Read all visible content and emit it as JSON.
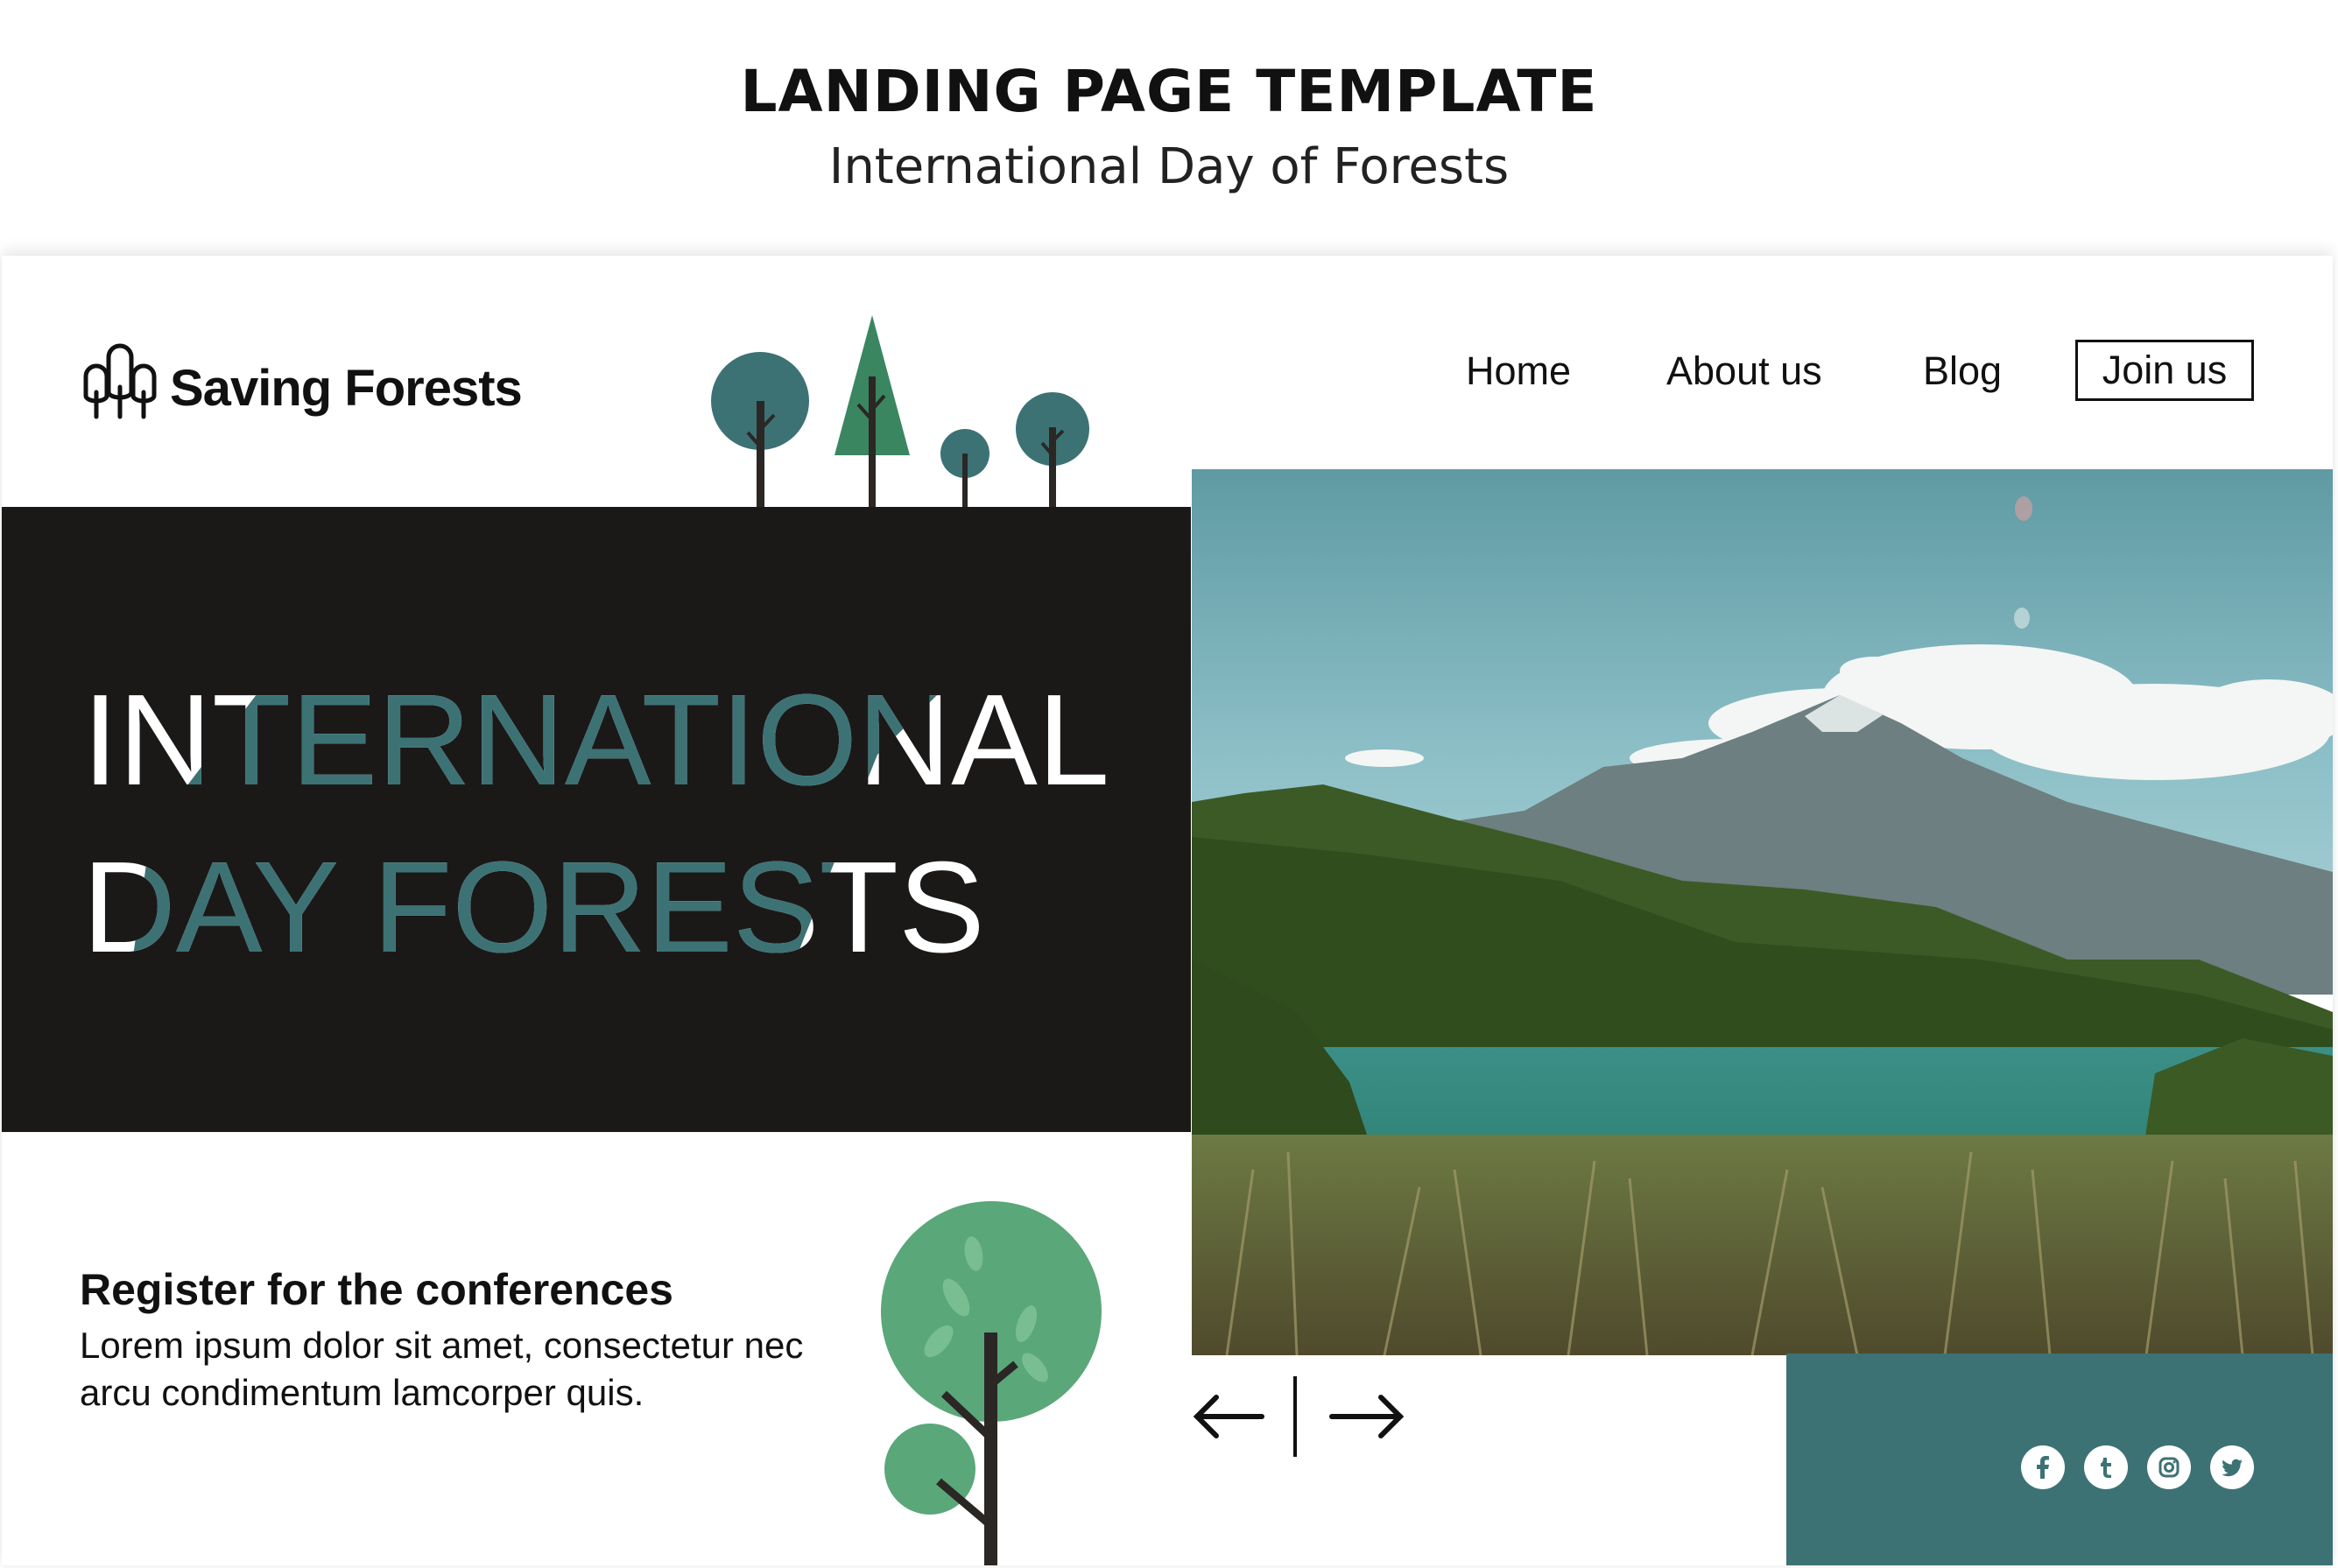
{
  "header": {
    "title": "LANDING PAGE TEMPLATE",
    "subtitle": "International Day of Forests"
  },
  "site": {
    "brand": "Saving Forests",
    "nav": {
      "home": "Home",
      "about": "About us",
      "blog": "Blog",
      "join": "Join us"
    }
  },
  "hero": {
    "line1": "INTERNATIONAL",
    "line2": "DAY FORESTS"
  },
  "register": {
    "heading": "Register for the conferences",
    "body": "Lorem ipsum dolor sit amet, consectetur nec arcu condimentum lamcorper quis."
  },
  "carousel": {
    "prev_icon": "arrow-left-icon",
    "next_icon": "arrow-right-icon"
  },
  "social": {
    "icons": [
      "facebook-icon",
      "tumblr-icon",
      "instagram-icon",
      "twitter-icon"
    ]
  },
  "colors": {
    "dark": "#1b1918",
    "teal": "#3d7275",
    "green": "#3a8660",
    "light_green": "#5aa77a"
  }
}
